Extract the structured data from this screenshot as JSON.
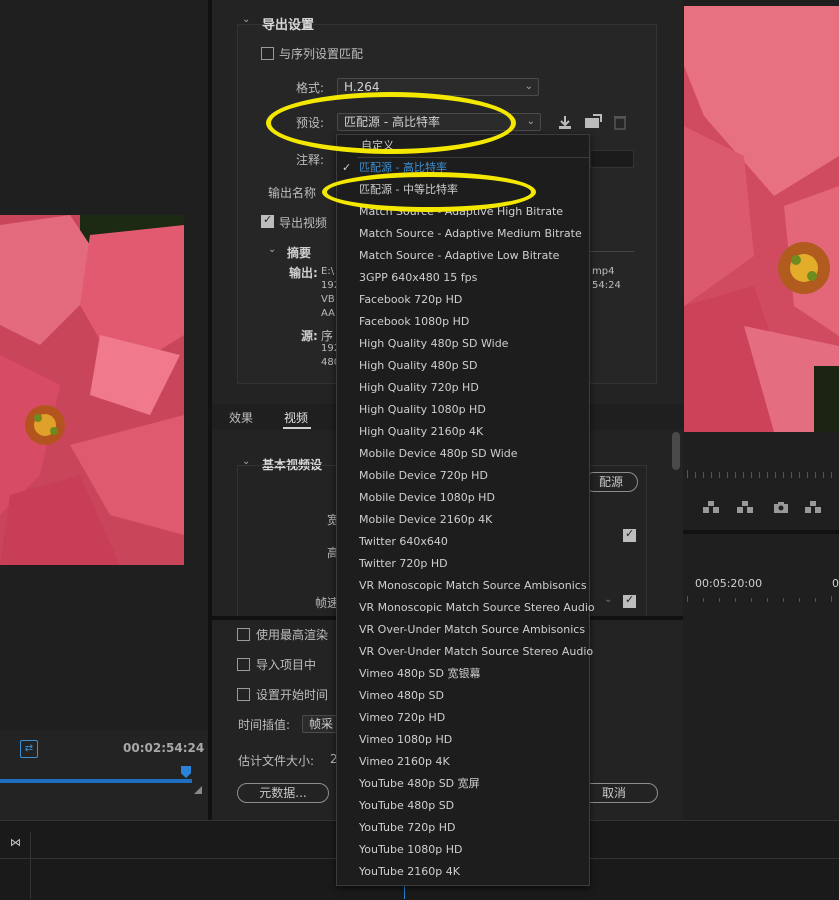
{
  "export_settings": {
    "section_title": "导出设置",
    "match_sequence_label": "与序列设置匹配",
    "format_label": "格式:",
    "format_value": "H.264",
    "preset_label": "预设:",
    "preset_value": "匹配源 - 高比特率",
    "comment_label": "注释:",
    "output_name_label": "输出名称",
    "export_video_label": "导出视频",
    "summary_title": "摘要",
    "output_label": "输出:",
    "output_lines": [
      "E:\\",
      "192",
      "VB",
      "AA"
    ],
    "output_right_lines": [
      "mp4",
      "54:24"
    ],
    "source_label": "源:",
    "source_lines": [
      "序",
      "192",
      "480"
    ]
  },
  "tabs": {
    "effects": "效果",
    "video": "视频"
  },
  "basic_video": {
    "title": "基本视频设",
    "match_source_button": "配源",
    "width_label": "宽",
    "height_label": "高",
    "framerate_label": "帧速"
  },
  "bottom_options": {
    "max_render": "使用最高渲染",
    "import_project": "导入项目中",
    "set_start_time": "设置开始时间",
    "time_interp_label": "时间插值:",
    "time_interp_value": "帧采",
    "estimated_size_label": "估计文件大小:",
    "estimated_size_value": "2",
    "metadata_button": "元数据...",
    "cancel_button": "取消"
  },
  "left_monitor": {
    "timecode": "00:02:54:24"
  },
  "right_monitor": {
    "timecode": "00:05:20:00",
    "timecode_edge": "0"
  },
  "dropdown": {
    "items": [
      "自定义",
      "匹配源 - 高比特率",
      "匹配源 - 中等比特率",
      "Match Source - Adaptive High Bitrate",
      "Match Source - Adaptive Medium Bitrate",
      "Match Source - Adaptive Low Bitrate",
      "3GPP 640x480 15 fps",
      "Facebook 720p HD",
      "Facebook 1080p HD",
      "High Quality 480p SD Wide",
      "High Quality 480p SD",
      "High Quality 720p HD",
      "High Quality 1080p HD",
      "High Quality 2160p 4K",
      "Mobile Device 480p SD Wide",
      "Mobile Device 720p HD",
      "Mobile Device 1080p HD",
      "Mobile Device 2160p 4K",
      "Twitter 640x640",
      "Twitter 720p HD",
      "VR Monoscopic Match Source Ambisonics",
      "VR Monoscopic Match Source Stereo Audio",
      "VR Over-Under Match Source Ambisonics",
      "VR Over-Under Match Source Stereo Audio",
      "Vimeo 480p SD 宽银幕",
      "Vimeo 480p SD",
      "Vimeo 720p HD",
      "Vimeo 1080p HD",
      "Vimeo 2160p 4K",
      "YouTube  480p  SD 宽屏",
      "YouTube 480p SD",
      "YouTube 720p HD",
      "YouTube 1080p HD",
      "YouTube 2160p 4K"
    ],
    "selected_index": 1
  },
  "colors": {
    "highlight_ring": "#f5e800",
    "selected_text": "#3d8fd1",
    "playhead": "#1e6fc0"
  }
}
